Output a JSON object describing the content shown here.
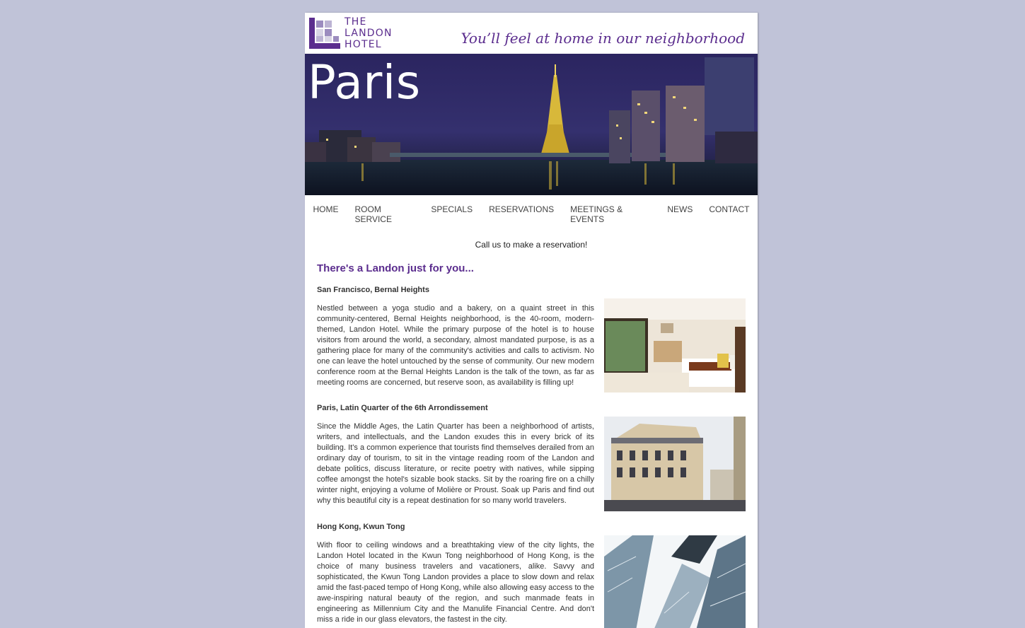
{
  "header": {
    "logo_lines": [
      "THE",
      "LANDON",
      "HOTEL"
    ],
    "tagline": "You’ll feel at home in our neighborhood"
  },
  "hero": {
    "title": "Paris"
  },
  "nav": {
    "items": [
      "HOME",
      "ROOM SERVICE",
      "SPECIALS",
      "RESERVATIONS",
      "MEETINGS & EVENTS",
      "NEWS",
      "CONTACT"
    ]
  },
  "callout": "Call us to make a reservation!",
  "main": {
    "heading": "There's a Landon just for you...",
    "locations": [
      {
        "title": "San Francisco, Bernal Heights",
        "text": "Nestled between a yoga studio and a bakery, on a quaint street in this community-centered, Bernal Heights neighborhood, is the 40-room, modern-themed, Landon Hotel. While the primary purpose of the hotel is to house visitors from around the world, a secondary, almost mandated purpose, is as a gathering place for many of the community's activities and calls to activism. No one can leave the hotel untouched by the sense of community. Our new modern conference room at the Bernal Heights Landon is the talk of the town, as far as meeting rooms are concerned, but reserve soon, as availability is filling up!"
      },
      {
        "title": "Paris, Latin Quarter of the 6th Arrondissement",
        "text": "Since the Middle Ages, the Latin Quarter has been a neighborhood of artists, writers, and intellectuals, and the Landon exudes this in every brick of its building. It's a common experience that tourists find themselves derailed from an ordinary day of tourism, to sit in the vintage reading room of the Landon and debate politics, discuss literature, or recite poetry with natives, while sipping coffee amongst the hotel's sizable book stacks. Sit by the roaring fire on a chilly winter night, enjoying a volume of Molière or Proust. Soak up Paris and find out why this beautiful city is a repeat destination for so many world travelers."
      },
      {
        "title": "Hong Kong, Kwun Tong",
        "text": "With floor to ceiling windows and a breathtaking view of the city lights, the Landon Hotel located in the Kwun Tong neighborhood of Hong Kong, is the choice of many business travelers and vacationers, alike. Savvy and sophisticated, the Kwun Tong Landon provides a place to slow down and relax amid the fast-paced tempo of Hong Kong, while also allowing easy access to the awe-inspiring natural beauty of the region, and such manmade feats in engineering as Millennium City and the Manulife Financial Centre. And don't miss a ride in our glass elevators, the fastest in the city."
      }
    ]
  },
  "colors": {
    "brand": "#5b2d8e",
    "background": "#c0c3d8"
  }
}
